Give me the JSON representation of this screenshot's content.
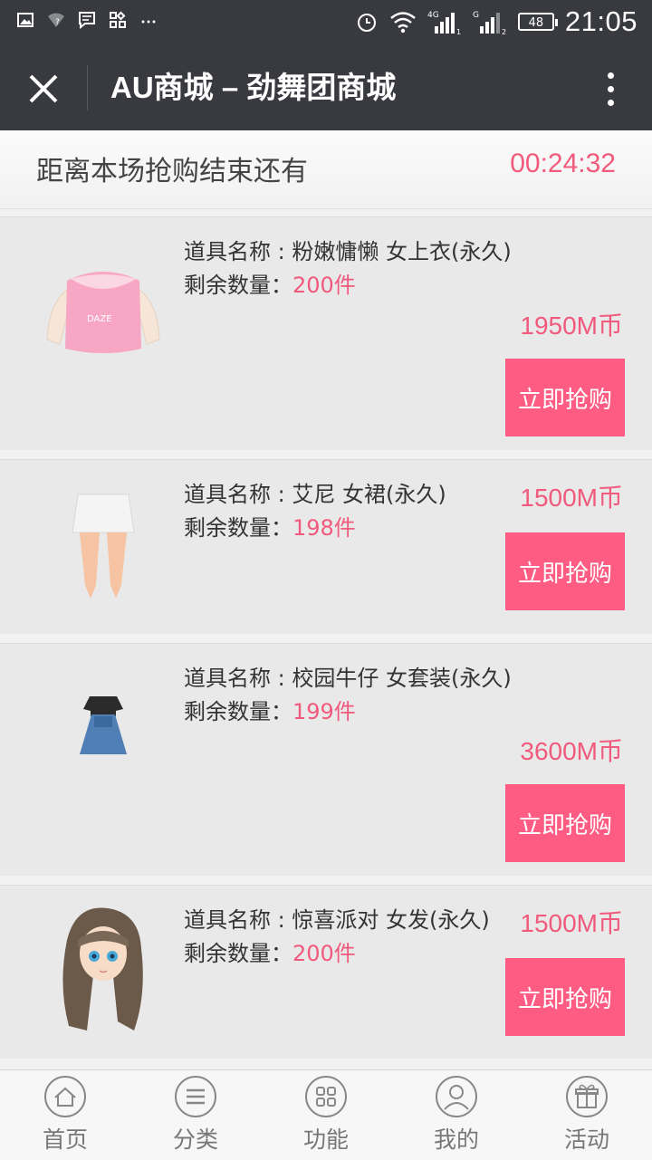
{
  "status_bar": {
    "time": "21:05",
    "battery": "48",
    "left_icons": [
      "image-icon",
      "wifi-question-icon",
      "message-icon",
      "apps-icon",
      "more-dots-icon"
    ],
    "right_icons": [
      "alarm-icon",
      "wifi-icon",
      "signal-4g-1-icon",
      "signal-g-2-icon",
      "battery-icon"
    ]
  },
  "header": {
    "title": "AU商城 – 劲舞团商城"
  },
  "countdown": {
    "label": "距离本场抢购结束还有",
    "time": "00:24:32"
  },
  "items": [
    {
      "name": "道具名称 : 粉嫩慵懒 女上衣(永久)",
      "qty_label": "剩余数量：",
      "qty": "200件",
      "price": "1950M币",
      "buy": "立即抢购",
      "image": "pink-top"
    },
    {
      "name": "道具名称 : 艾尼 女裙(永久)",
      "qty_label": "剩余数量：",
      "qty": "198件",
      "price": "1500M币",
      "buy": "立即抢购",
      "image": "white-skirt"
    },
    {
      "name": "道具名称 : 校园牛仔 女套装(永久)",
      "qty_label": "剩余数量：",
      "qty": "199件",
      "price": "3600M币",
      "buy": "立即抢购",
      "image": "denim-dress"
    },
    {
      "name": "道具名称 : 惊喜派对 女发(永久)",
      "qty_label": "剩余数量：",
      "qty": "200件",
      "price": "1500M币",
      "buy": "立即抢购",
      "image": "brown-hair"
    }
  ],
  "tabs": [
    {
      "label": "首页",
      "icon": "home-icon"
    },
    {
      "label": "分类",
      "icon": "menu-icon"
    },
    {
      "label": "功能",
      "icon": "grid-icon"
    },
    {
      "label": "我的",
      "icon": "user-icon"
    },
    {
      "label": "活动",
      "icon": "gift-icon"
    }
  ],
  "colors": {
    "header_bg": "#393a3f",
    "accent": "#f15a7d",
    "button_bg": "#fe5c83",
    "card_bg": "#e9e9e9"
  }
}
